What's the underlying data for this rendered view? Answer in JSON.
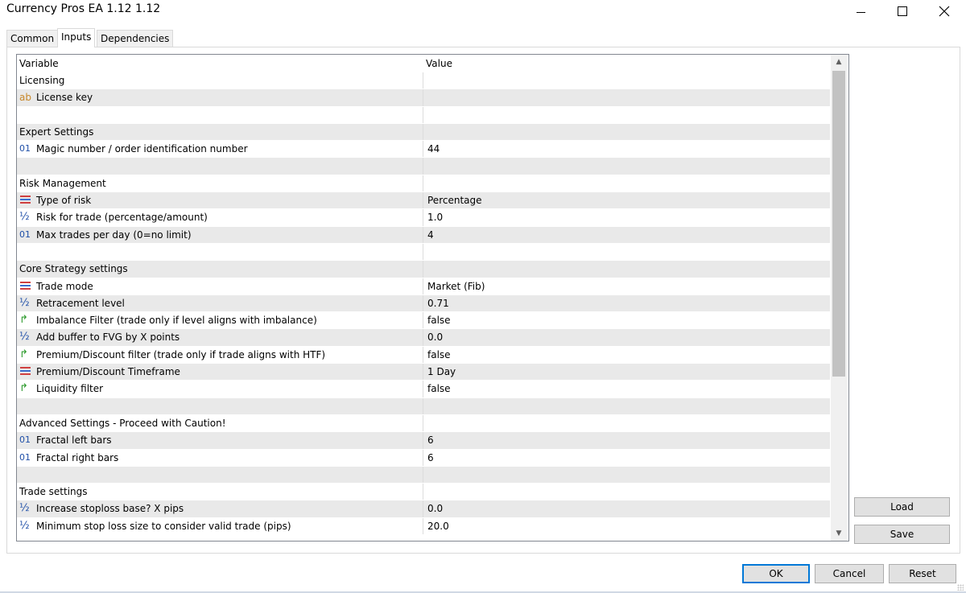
{
  "window": {
    "title": "Currency Pros EA 1.12 1.12"
  },
  "tabs": [
    {
      "label": "Common",
      "active": false
    },
    {
      "label": "Inputs",
      "active": true
    },
    {
      "label": "Dependencies",
      "active": false
    }
  ],
  "grid": {
    "headers": {
      "variable": "Variable",
      "value": "Value"
    },
    "rows": [
      {
        "type": "section",
        "variable": "Licensing",
        "value": "",
        "shade": false
      },
      {
        "type": "string",
        "variable": "License key",
        "value": "",
        "shade": true
      },
      {
        "type": "blank",
        "variable": "",
        "value": "",
        "shade": false
      },
      {
        "type": "section",
        "variable": "Expert Settings",
        "value": "",
        "shade": true
      },
      {
        "type": "int",
        "variable": "Magic number / order identification number",
        "value": "44",
        "shade": false
      },
      {
        "type": "blank",
        "variable": "",
        "value": "",
        "shade": true
      },
      {
        "type": "section",
        "variable": "Risk Management",
        "value": "",
        "shade": false
      },
      {
        "type": "enum",
        "variable": "Type of risk",
        "value": "Percentage",
        "shade": true
      },
      {
        "type": "double",
        "variable": "Risk for trade (percentage/amount)",
        "value": "1.0",
        "shade": false
      },
      {
        "type": "int",
        "variable": "Max trades per day (0=no limit)",
        "value": "4",
        "shade": true
      },
      {
        "type": "blank",
        "variable": "",
        "value": "",
        "shade": false
      },
      {
        "type": "section",
        "variable": "Core Strategy settings",
        "value": "",
        "shade": true
      },
      {
        "type": "enum",
        "variable": "Trade mode",
        "value": "Market (Fib)",
        "shade": false
      },
      {
        "type": "double",
        "variable": "Retracement level",
        "value": "0.71",
        "shade": true
      },
      {
        "type": "bool",
        "variable": "Imbalance Filter (trade only if level aligns with imbalance)",
        "value": "false",
        "shade": false
      },
      {
        "type": "double",
        "variable": "Add buffer to FVG by X points",
        "value": "0.0",
        "shade": true
      },
      {
        "type": "bool",
        "variable": "Premium/Discount filter (trade only if trade aligns with HTF)",
        "value": "false",
        "shade": false
      },
      {
        "type": "enum",
        "variable": "Premium/Discount Timeframe",
        "value": "1 Day",
        "shade": true
      },
      {
        "type": "bool",
        "variable": "Liquidity filter",
        "value": "false",
        "shade": false
      },
      {
        "type": "blank",
        "variable": "",
        "value": "",
        "shade": true
      },
      {
        "type": "section",
        "variable": "Advanced Settings - Proceed with Caution!",
        "value": "",
        "shade": false
      },
      {
        "type": "int",
        "variable": "Fractal left bars",
        "value": "6",
        "shade": true
      },
      {
        "type": "int",
        "variable": "Fractal right bars",
        "value": "6",
        "shade": false
      },
      {
        "type": "blank",
        "variable": "",
        "value": "",
        "shade": true
      },
      {
        "type": "section",
        "variable": "Trade settings",
        "value": "",
        "shade": false
      },
      {
        "type": "double",
        "variable": "Increase stoploss base? X pips",
        "value": "0.0",
        "shade": true
      },
      {
        "type": "double",
        "variable": "Minimum stop loss size to consider valid trade (pips)",
        "value": "20.0",
        "shade": false
      }
    ]
  },
  "icons": {
    "string": "ab",
    "int": "01",
    "double": "½",
    "bool": "↱",
    "enum_colors": [
      "#d04040",
      "#3a6fd0",
      "#d04040"
    ]
  },
  "buttons": {
    "load": "Load",
    "save": "Save",
    "ok": "OK",
    "cancel": "Cancel",
    "reset": "Reset"
  },
  "scrollbar": {
    "up": "▲",
    "down": "▼"
  }
}
